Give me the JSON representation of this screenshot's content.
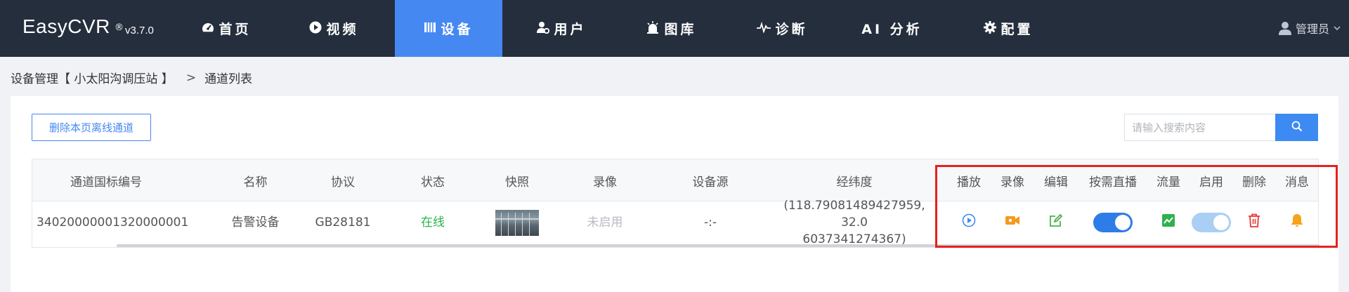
{
  "app": {
    "name": "EasyCVR",
    "registered": "®",
    "version": "v3.7.0"
  },
  "nav": [
    {
      "label": "首页",
      "icon": "dashboard-icon"
    },
    {
      "label": "视频",
      "icon": "play-circle-icon"
    },
    {
      "label": "设备",
      "icon": "device-icon",
      "active": true
    },
    {
      "label": "用户",
      "icon": "user-gear-icon"
    },
    {
      "label": "图库",
      "icon": "camera-alarm-icon"
    },
    {
      "label": "诊断",
      "icon": "pulse-icon"
    },
    {
      "label": "AI 分析",
      "icon": ""
    },
    {
      "label": "配置",
      "icon": "gear-icon"
    }
  ],
  "user": {
    "name": "管理员",
    "icon": "user-icon"
  },
  "breadcrumb": {
    "device": "设备管理【 小太阳沟调压站 】",
    "separator": ">",
    "current": "通道列表"
  },
  "toolbar": {
    "delete_offline_label": "删除本页离线通道",
    "search_placeholder": "请输入搜索内容"
  },
  "table": {
    "headers": [
      "通道国标编号",
      "名称",
      "协议",
      "状态",
      "快照",
      "录像",
      "设备源",
      "经纬度",
      "播放",
      "录像",
      "编辑",
      "按需直播",
      "流量",
      "启用",
      "删除",
      "消息"
    ],
    "rows": [
      {
        "channel_id": "34020000001320000001",
        "name": "告警设备",
        "protocol": "GB28181",
        "status": "在线",
        "record": "未启用",
        "source": "-:-",
        "coords_line1": "(118.79081489427959, 32.0",
        "coords_line2": "6037341274367)",
        "on_demand_enabled": true,
        "enabled": true
      }
    ]
  },
  "colors": {
    "nav_bg": "#252e3d",
    "nav_active": "#4688f1",
    "online": "#29b34a",
    "play": "#3d8af3",
    "record": "#f39a1e",
    "edit": "#4cb050",
    "toggle_on": "#2e7ce8",
    "toggle_disabled": "#a9cff5",
    "flow": "#2db24d",
    "delete": "#e53935",
    "message": "#f7a21b",
    "highlight": "#e8201d"
  }
}
